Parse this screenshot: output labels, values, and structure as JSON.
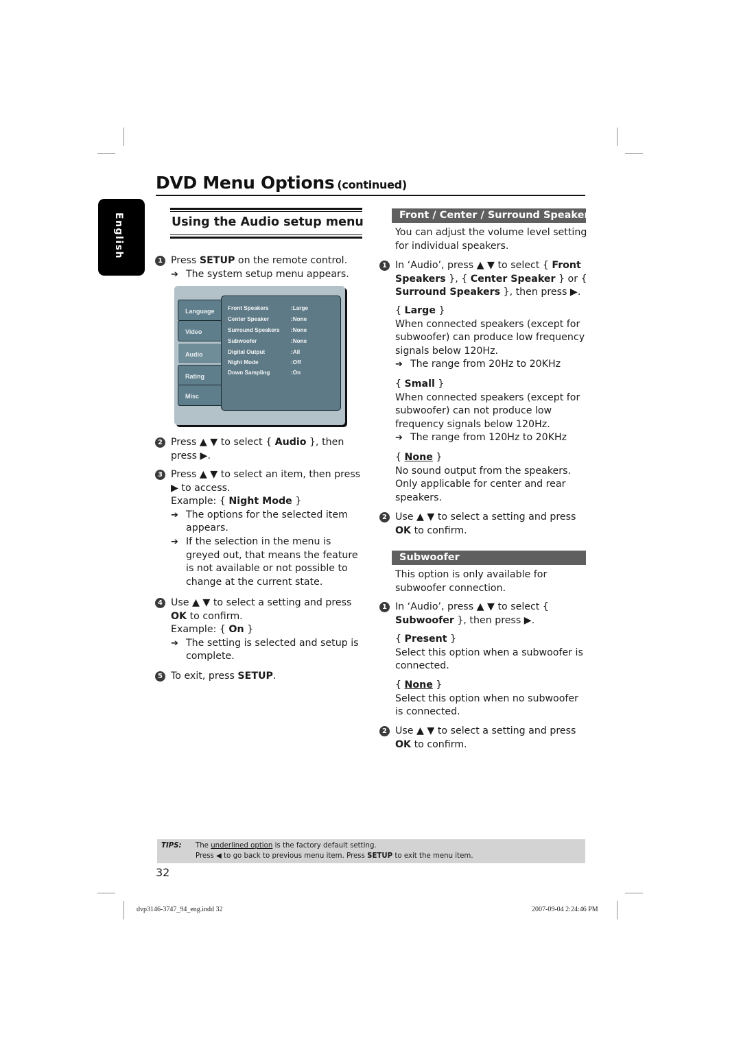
{
  "page": {
    "title": "DVD Menu Options",
    "title_suffix": "(continued)",
    "language_tab": "English",
    "page_number": "32"
  },
  "left": {
    "section_title": "Using the Audio setup menu",
    "steps": [
      {
        "num": "1",
        "pre": "Press ",
        "bold": "SETUP",
        "post": " on the remote control.",
        "result": "The system setup menu appears."
      },
      {
        "num": "2",
        "pre": "Press ▲ ▼ to select { ",
        "bold": "Audio",
        "post": " }, then press ▶."
      },
      {
        "num": "3",
        "text": "Press ▲ ▼ to select an item, then press ▶ to access.",
        "example_pre": "Example: { ",
        "example_bold": "Night Mode",
        "example_post": " }",
        "result1": "The options for the selected item appears.",
        "result2": "If the selection in the menu is greyed out, that means the feature is not available or not possible to change at the current state."
      },
      {
        "num": "4",
        "pre": "Use ▲ ▼ to select a setting and press ",
        "bold": "OK",
        "post": " to confirm.",
        "example_pre": "Example: { ",
        "example_bold": "On",
        "example_post": " }",
        "result": "The setting is selected and setup is complete."
      },
      {
        "num": "5",
        "pre": "To exit, press ",
        "bold": "SETUP",
        "post": "."
      }
    ]
  },
  "setup_menu": {
    "tabs": [
      "Language",
      "Video",
      "Audio",
      "Rating",
      "Misc"
    ],
    "active_tab": "Audio",
    "items": [
      {
        "label": "Front Speakers",
        "value": ":Large"
      },
      {
        "label": "Center Speaker",
        "value": ":None"
      },
      {
        "label": "Surround Speakers",
        "value": ":None"
      },
      {
        "label": "Subwoofer",
        "value": ":None"
      },
      {
        "label": "Digital Output",
        "value": ":All"
      },
      {
        "label": "Night  Mode",
        "value": ":Off"
      },
      {
        "label": "Down Sampling",
        "value": ":On"
      }
    ]
  },
  "right": {
    "speakers": {
      "heading": "Front / Center / Surround Speakers",
      "intro": "You can adjust the volume level setting for individual speakers.",
      "step1": {
        "num": "1",
        "pre": "In ‘Audio’, press ▲ ▼ to select { ",
        "b1": "Front Speakers",
        "mid1": " }, { ",
        "b2": "Center Speaker",
        "mid2": " } or { ",
        "b3": "Surround Speakers",
        "post": " }, then press ▶."
      },
      "options": [
        {
          "name": "Large",
          "underlined": false,
          "desc": "When connected speakers (except for subwoofer) can produce low frequency signals below 120Hz.",
          "result": "The range from 20Hz to 20KHz"
        },
        {
          "name": "Small",
          "underlined": false,
          "desc": "When connected speakers (except for subwoofer) can not produce low frequency signals below 120Hz.",
          "result": "The range from 120Hz to 20KHz"
        },
        {
          "name": "None",
          "underlined": true,
          "desc": "No sound output from the speakers. Only applicable for center and rear speakers."
        }
      ],
      "step2": {
        "num": "2",
        "pre": "Use ▲ ▼ to select a setting and press ",
        "bold": "OK",
        "post": " to confirm."
      }
    },
    "subwoofer": {
      "heading": "Subwoofer",
      "intro": "This option is only available for subwoofer connection.",
      "step1": {
        "num": "1",
        "pre": "In ‘Audio’, press ▲ ▼ to select { ",
        "bold": "Subwoofer",
        "post": " }, then press ▶."
      },
      "options": [
        {
          "name": "Present",
          "underlined": false,
          "desc": "Select this option when a subwoofer is connected."
        },
        {
          "name": "None",
          "underlined": true,
          "desc": "Select this option when no subwoofer is connected."
        }
      ],
      "step2": {
        "num": "2",
        "pre": "Use ▲ ▼ to select a setting and press ",
        "bold": "OK",
        "post": " to confirm."
      }
    }
  },
  "tips": {
    "label": "TIPS:",
    "line1_pre": "The ",
    "line1_underlined": "underlined option",
    "line1_post": " is the factory default setting.",
    "line2_pre": "Press  ◀ to go back to previous menu item. Press ",
    "line2_bold": "SETUP",
    "line2_post": " to exit the menu item."
  },
  "slug": {
    "file": "dvp3146-3747_94_eng.indd   32",
    "timestamp": "2007-09-04   2:24:46 PM"
  }
}
